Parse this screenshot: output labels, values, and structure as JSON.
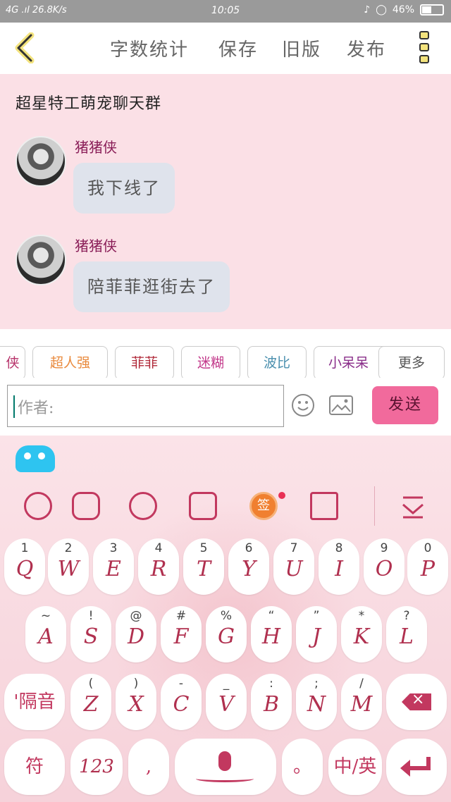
{
  "status_bar": {
    "signal_text": "4G .ıl 26.8K/s",
    "time": "10:05",
    "battery": "46%"
  },
  "header": {
    "word_count": "字数统计",
    "save": "保存",
    "old_version": "旧版",
    "publish": "发布"
  },
  "chat": {
    "group_title": "超星特工萌宠聊天群",
    "messages": [
      {
        "sender": "猪猪侠",
        "text": "我下线了"
      },
      {
        "sender": "猪猪侠",
        "text": "陪菲菲逛街去了"
      }
    ]
  },
  "authors": {
    "items": [
      {
        "label": "侠",
        "color": "#b7336a"
      },
      {
        "label": "超人强",
        "color": "#e98a3d"
      },
      {
        "label": "菲菲",
        "color": "#b02838"
      },
      {
        "label": "迷糊",
        "color": "#c2388a"
      },
      {
        "label": "波比",
        "color": "#4a8fae"
      },
      {
        "label": "小呆呆",
        "color": "#8a2e8a"
      }
    ],
    "more": "更多"
  },
  "composer": {
    "placeholder": "作者:",
    "send": "发送"
  },
  "keyboard": {
    "toolbar": {
      "sign_label": "签"
    },
    "row1": [
      {
        "num": "1",
        "letter": "Q"
      },
      {
        "num": "2",
        "letter": "W"
      },
      {
        "num": "3",
        "letter": "E"
      },
      {
        "num": "4",
        "letter": "R"
      },
      {
        "num": "5",
        "letter": "T"
      },
      {
        "num": "6",
        "letter": "Y"
      },
      {
        "num": "7",
        "letter": "U"
      },
      {
        "num": "8",
        "letter": "I"
      },
      {
        "num": "9",
        "letter": "O"
      },
      {
        "num": "0",
        "letter": "P"
      }
    ],
    "row2": [
      {
        "num": "~",
        "letter": "A"
      },
      {
        "num": "!",
        "letter": "S"
      },
      {
        "num": "@",
        "letter": "D"
      },
      {
        "num": "#",
        "letter": "F"
      },
      {
        "num": "%",
        "letter": "G"
      },
      {
        "num": "“",
        "letter": "H"
      },
      {
        "num": "”",
        "letter": "J"
      },
      {
        "num": "*",
        "letter": "K"
      },
      {
        "num": "?",
        "letter": "L"
      }
    ],
    "row3": [
      {
        "num": "(",
        "letter": "Z"
      },
      {
        "num": ")",
        "letter": "X"
      },
      {
        "num": "-",
        "letter": "C"
      },
      {
        "num": "_",
        "letter": "V"
      },
      {
        "num": ":",
        "letter": "B"
      },
      {
        "num": ";",
        "letter": "N"
      },
      {
        "num": "/",
        "letter": "M"
      }
    ],
    "separator_key": "'隔音",
    "symbol_key": "符",
    "number_key": "123",
    "comma_key": ",",
    "period_key": "。",
    "lang_key": "中/英"
  }
}
